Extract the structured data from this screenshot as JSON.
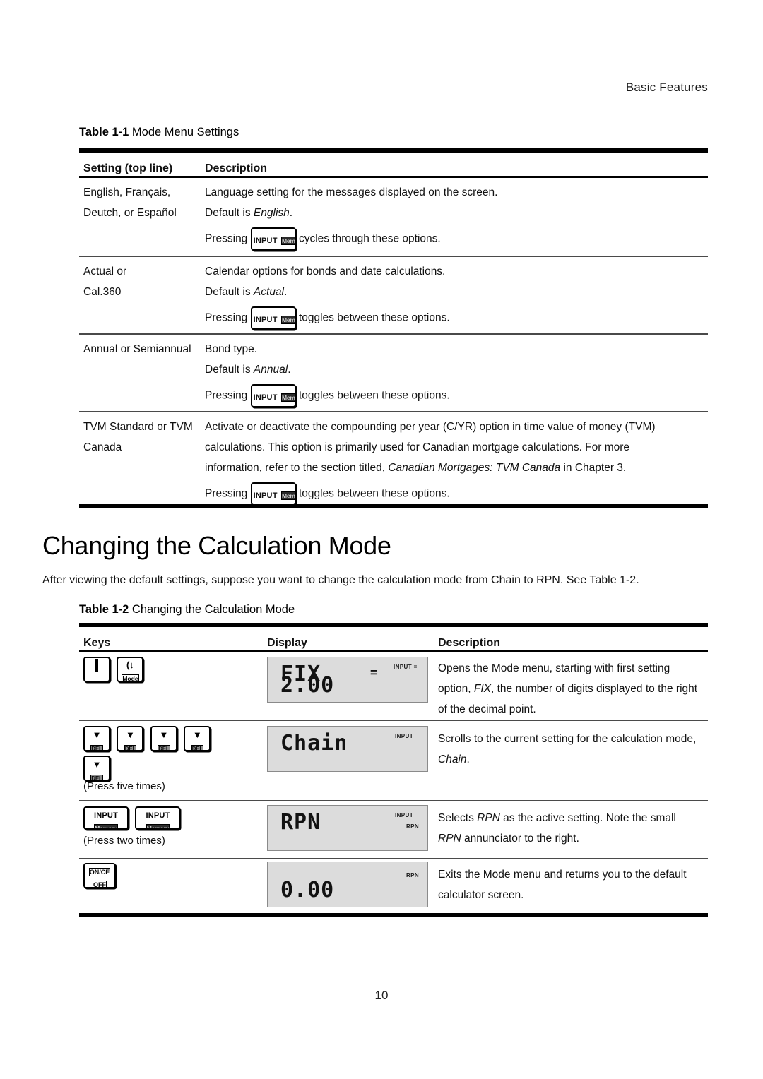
{
  "running_head": "Basic Features",
  "page_number": "10",
  "table1": {
    "caption_strong": "Table 1-1",
    "caption_rest": " Mode Menu Settings",
    "headers": {
      "col1": "Setting (top line)",
      "col2": "Description"
    },
    "rows": [
      {
        "setting_line1": "English, Français,",
        "setting_line2": "Deutch, or Español",
        "desc_line1": "Language setting for the messages displayed on the screen.",
        "desc_line2_pre": "Default is ",
        "desc_line2_ital": "English",
        "desc_line2_post": ".",
        "press_pre": "Pressing",
        "press_post": "cycles through these options.",
        "key_top": "INPUT",
        "key_bottom": "Memory"
      },
      {
        "setting_line1": "Actual or",
        "setting_line2": "Cal.360",
        "desc_line1": "Calendar options for bonds and date calculations.",
        "desc_line2_pre": "Default is ",
        "desc_line2_ital": "Actual",
        "desc_line2_post": ".",
        "press_pre": "Pressing",
        "press_post": "toggles between these options.",
        "key_top": "INPUT",
        "key_bottom": "Memory"
      },
      {
        "setting_line1": "Annual or Semiannual",
        "setting_line2": "",
        "desc_line1": "Bond type.",
        "desc_line2_pre": "Default is ",
        "desc_line2_ital": "Annual",
        "desc_line2_post": ".",
        "press_pre": "Pressing",
        "press_post": "toggles between these options.",
        "key_top": "INPUT",
        "key_bottom": "Memory"
      },
      {
        "setting_line1": "TVM Standard or TVM",
        "setting_line2": "Canada",
        "desc_line1": "Activate or deactivate the compounding per year (C/YR) option in time value of money (TVM)",
        "desc_line2": "calculations. This option is primarily used for Canadian mortgage calculations. For more",
        "desc_line3_pre": "information, refer to the section titled, ",
        "desc_line3_ital": "Canadian Mortgages: TVM Canada",
        "desc_line3_post": " in Chapter 3.",
        "press_pre": "Pressing",
        "press_post": "toggles between these options.",
        "key_top": "INPUT",
        "key_bottom": "Memory"
      }
    ]
  },
  "section": {
    "heading": "Changing the Calculation Mode",
    "intro": "After viewing the default settings, suppose you want to change the calculation mode from Chain to RPN. See Table 1-2."
  },
  "table2": {
    "caption_strong": "Table 1-2",
    "caption_rest": " Changing the Calculation Mode",
    "headers": {
      "keys": "Keys",
      "display": "Display",
      "description": "Description"
    },
    "rows": [
      {
        "keys": [
          {
            "type": "shift",
            "top": "",
            "bottom": ""
          },
          {
            "type": "mode",
            "glyph": "(↓",
            "bottom": "Mode"
          }
        ],
        "press_note": "",
        "display": {
          "line1": "FIX",
          "line2": "2.00",
          "equals": "=",
          "annunciators": [
            "INPUT ="
          ]
        },
        "desc_line1": "Opens the Mode menu, starting with first setting",
        "desc_line2_pre": "option, ",
        "desc_line2_ital": "FIX",
        "desc_line2_post": ", the number of digits displayed to the right",
        "desc_line3": "of the decimal point."
      },
      {
        "keys": [
          {
            "type": "del",
            "glyph": "▼",
            "bottom": "DEL"
          },
          {
            "type": "del",
            "glyph": "▼",
            "bottom": "DEL"
          },
          {
            "type": "del",
            "glyph": "▼",
            "bottom": "DEL"
          },
          {
            "type": "del",
            "glyph": "▼",
            "bottom": "DEL"
          },
          {
            "type": "del",
            "glyph": "▼",
            "bottom": "DEL"
          }
        ],
        "press_note": "(Press five times)",
        "display": {
          "line1": "Chain",
          "line2": "",
          "equals": "",
          "annunciators": [
            "INPUT"
          ]
        },
        "desc_line1": "Scrolls to the current setting for the calculation mode,",
        "desc_line2_ital": "Chain",
        "desc_line2_post": "."
      },
      {
        "keys": [
          {
            "type": "input",
            "top": "INPUT",
            "bottom": "Memory"
          },
          {
            "type": "input",
            "top": "INPUT",
            "bottom": "Memory"
          }
        ],
        "press_note": "(Press two times)",
        "display": {
          "line1": "RPN",
          "line2": "",
          "equals": "",
          "annunciators": [
            "INPUT",
            "RPN"
          ]
        },
        "desc_line1_pre": "Selects ",
        "desc_line1_ital": "RPN",
        "desc_line1_post": " as the active setting. Note the small",
        "desc_line2_ital": "RPN",
        "desc_line2_post": " annunciator to the right."
      },
      {
        "keys": [
          {
            "type": "onoff",
            "top": "ON/CE",
            "bottom": "OFF"
          }
        ],
        "press_note": "",
        "display": {
          "line1": "",
          "line2": "0.00",
          "equals": "",
          "annunciators": [
            "RPN"
          ]
        },
        "desc_line1": "Exits the Mode menu and returns you to the default",
        "desc_line2": "calculator screen."
      }
    ]
  }
}
